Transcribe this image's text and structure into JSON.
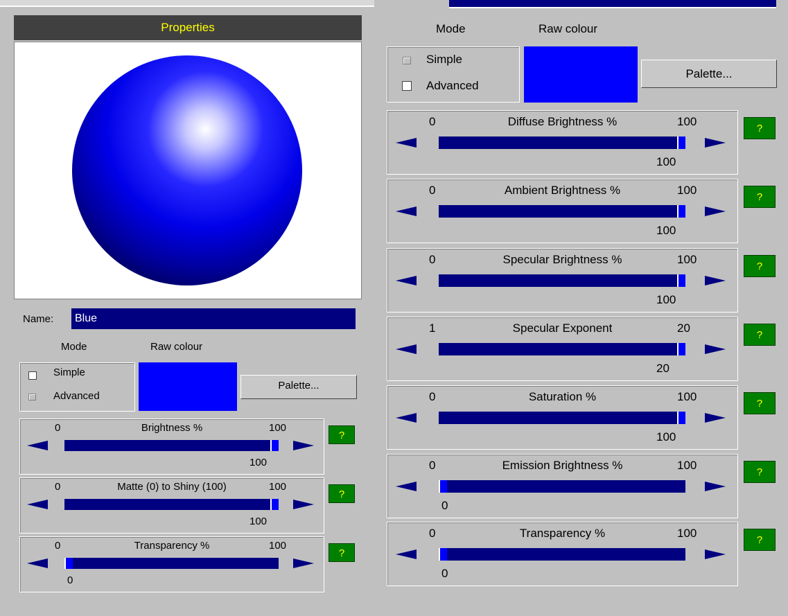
{
  "properties": {
    "title": "Properties"
  },
  "name": {
    "label": "Name:",
    "value": "Blue"
  },
  "colours": {
    "raw": "#0000ff",
    "track": "#000080",
    "sphere_highlight": "#ffffff"
  },
  "left": {
    "mode_label": "Mode",
    "raw_label": "Raw colour",
    "simple_label": "Simple",
    "advanced_label": "Advanced",
    "palette_label": "Palette...",
    "sliders": [
      {
        "title": "Brightness %",
        "min": "0",
        "max": "100",
        "value": "100",
        "fraction": 1.0,
        "help": "?"
      },
      {
        "title": "Matte (0) to Shiny (100)",
        "min": "0",
        "max": "100",
        "value": "100",
        "fraction": 1.0,
        "help": "?"
      },
      {
        "title": "Transparency %",
        "min": "0",
        "max": "100",
        "value": "0",
        "fraction": 0.0,
        "help": "?"
      }
    ]
  },
  "right": {
    "mode_label": "Mode",
    "raw_label": "Raw colour",
    "simple_label": "Simple",
    "advanced_label": "Advanced",
    "palette_label": "Palette...",
    "sliders": [
      {
        "title": "Diffuse Brightness %",
        "min": "0",
        "max": "100",
        "value": "100",
        "fraction": 1.0,
        "help": "?"
      },
      {
        "title": "Ambient Brightness %",
        "min": "0",
        "max": "100",
        "value": "100",
        "fraction": 1.0,
        "help": "?"
      },
      {
        "title": "Specular Brightness %",
        "min": "0",
        "max": "100",
        "value": "100",
        "fraction": 1.0,
        "help": "?"
      },
      {
        "title": "Specular Exponent",
        "min": "1",
        "max": "20",
        "value": "20",
        "fraction": 1.0,
        "help": "?"
      },
      {
        "title": "Saturation %",
        "min": "0",
        "max": "100",
        "value": "100",
        "fraction": 1.0,
        "help": "?"
      },
      {
        "title": "Emission Brightness %",
        "min": "0",
        "max": "100",
        "value": "0",
        "fraction": 0.0,
        "help": "?"
      },
      {
        "title": "Transparency %",
        "min": "0",
        "max": "100",
        "value": "0",
        "fraction": 0.0,
        "help": "?"
      }
    ]
  }
}
